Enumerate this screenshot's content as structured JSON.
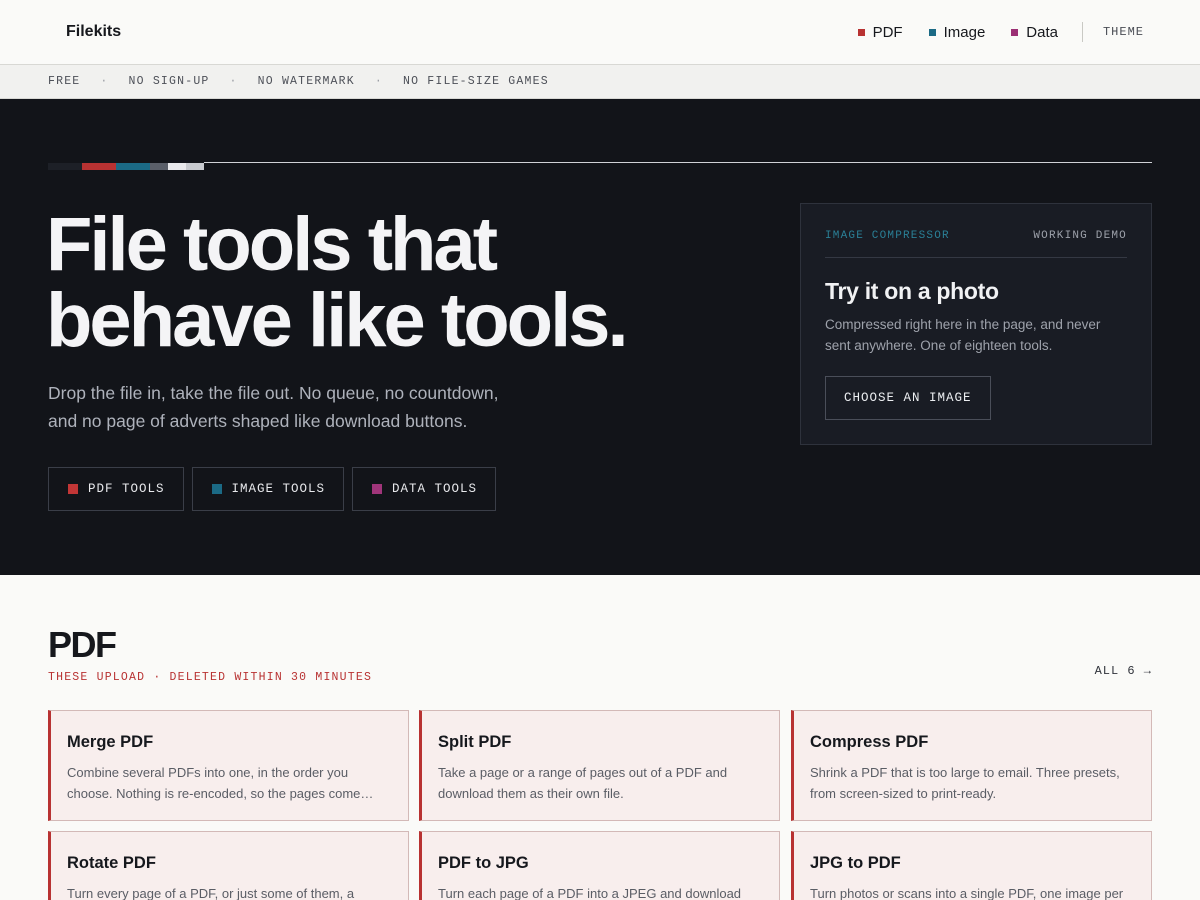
{
  "header": {
    "brand": "Filekits",
    "nav": [
      {
        "label": "PDF",
        "color": "#b83232"
      },
      {
        "label": "Image",
        "color": "#1b6a85"
      },
      {
        "label": "Data",
        "color": "#9b2f74"
      }
    ],
    "theme_label": "THEME"
  },
  "strip": {
    "items": [
      "FREE",
      "NO SIGN-UP",
      "NO WATERMARK",
      "NO FILE-SIZE GAMES"
    ],
    "separator": "·"
  },
  "hero": {
    "bar_colors": [
      "#1d2027",
      "#b83232",
      "#1b6a85",
      "#5a5f69",
      "#e9e9ec",
      "#c8cacf"
    ],
    "title_line1": "File tools that",
    "title_line2": "behave like tools.",
    "subtitle_line1": "Drop the file in, take the file out. No queue, no countdown,",
    "subtitle_line2": "and no page of adverts shaped like download buttons.",
    "buttons": [
      {
        "label": "PDF TOOLS",
        "color": "#c23636"
      },
      {
        "label": "IMAGE TOOLS",
        "color": "#1b6a85"
      },
      {
        "label": "DATA TOOLS",
        "color": "#a0357a"
      }
    ]
  },
  "demo": {
    "tool_label": "IMAGE COMPRESSOR",
    "status_label": "WORKING DEMO",
    "title": "Try it on a photo",
    "text": "Compressed right here in the page, and never sent anywhere. One of eighteen tools.",
    "button_label": "CHOOSE AN IMAGE"
  },
  "pdf_section": {
    "title": "PDF",
    "subtitle": "THESE UPLOAD · DELETED WITHIN 30 MINUTES",
    "all_label": "ALL 6 →",
    "accent": "#b83232",
    "cards": [
      {
        "title": "Merge PDF",
        "desc": "Combine several PDFs into one, in the order you choose. Nothing is re-encoded, so the pages come…"
      },
      {
        "title": "Split PDF",
        "desc": "Take a page or a range of pages out of a PDF and download them as their own file."
      },
      {
        "title": "Compress PDF",
        "desc": "Shrink a PDF that is too large to email. Three presets, from screen-sized to print-ready."
      },
      {
        "title": "Rotate PDF",
        "desc": "Turn every page of a PDF, or just some of them, a"
      },
      {
        "title": "PDF to JPG",
        "desc": "Turn each page of a PDF into a JPEG and download"
      },
      {
        "title": "JPG to PDF",
        "desc": "Turn photos or scans into a single PDF, one image per"
      }
    ]
  }
}
